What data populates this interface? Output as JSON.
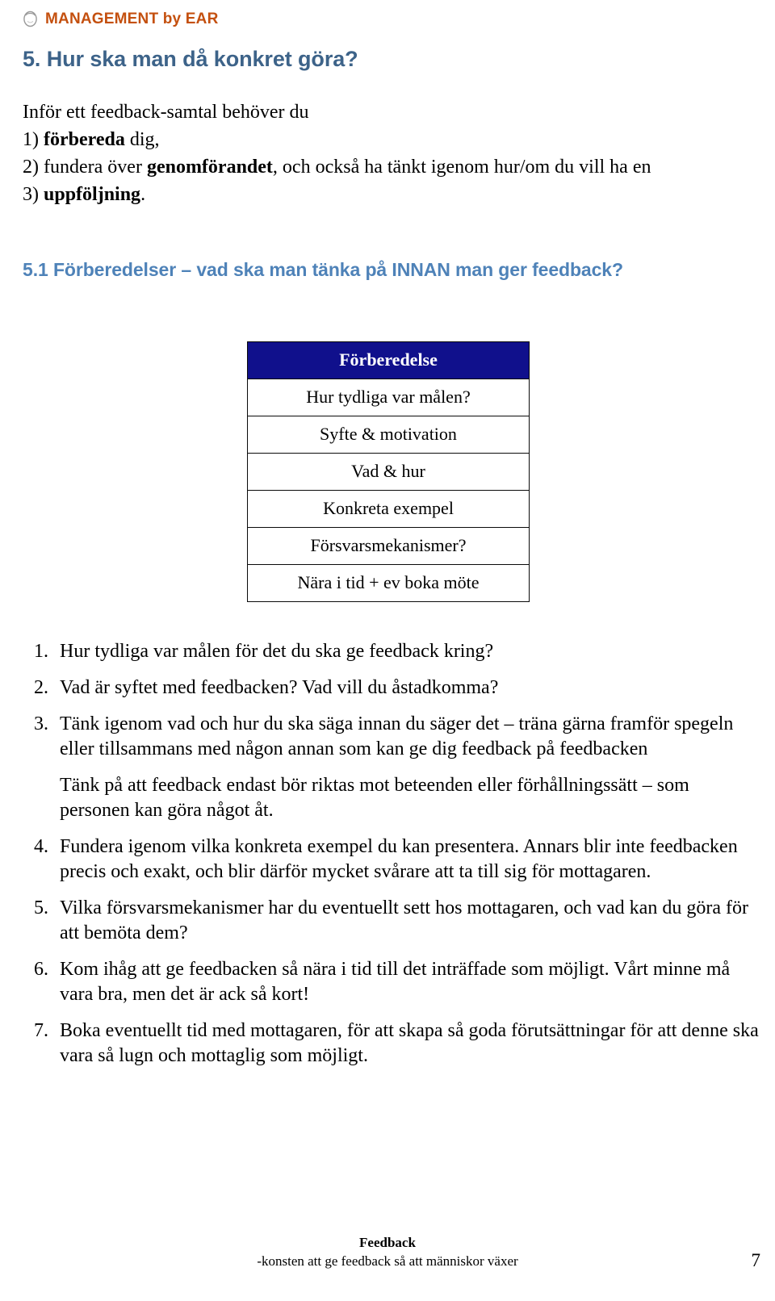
{
  "brand": {
    "logo_icon": "head-outline-icon",
    "text": "MANAGEMENT by EAR",
    "color": "#c4500f"
  },
  "headings": {
    "section": "5. Hur ska man då konkret göra?",
    "section_color": "#3d6389",
    "subsection": "5.1 Förberedelser – vad ska man tänka på INNAN man ger feedback?",
    "subsection_color": "#4e82b8"
  },
  "intro": {
    "line1": "Inför ett feedback-samtal behöver du",
    "line2_num": "1)",
    "line2_bold": "förbereda",
    "line2_rest": " dig,",
    "line3_num": "2)",
    "line3_pre": " fundera över ",
    "line3_bold": "genomförandet",
    "line3_rest": ", och också ha tänkt igenom hur/om du vill ha en",
    "line4_num": "3)",
    "line4_bold": "uppföljning",
    "line4_rest": "."
  },
  "prep_table": {
    "header": "Förberedelse",
    "header_bg": "#10108c",
    "rows": [
      "Hur tydliga var målen?",
      "Syfte & motivation",
      "Vad & hur",
      "Konkreta exempel",
      "Försvarsmekanismer?",
      "Nära i tid + ev boka möte"
    ]
  },
  "list": {
    "items": [
      {
        "num": "1.",
        "text": "Hur tydliga var målen för det du ska ge feedback kring?",
        "extra": null
      },
      {
        "num": "2.",
        "text": "Vad är syftet med feedbacken? Vad vill du åstadkomma?",
        "extra": null
      },
      {
        "num": "3.",
        "text": "Tänk igenom vad och hur du ska säga innan du säger det – träna gärna framför spegeln eller tillsammans med någon annan som kan ge dig feedback på feedbacken",
        "extra": "Tänk på att feedback endast bör riktas mot beteenden eller förhållningssätt – som personen kan göra något åt."
      },
      {
        "num": "4.",
        "text": "Fundera igenom vilka konkreta exempel du kan presentera. Annars blir inte feedbacken precis och exakt, och blir därför mycket svårare att ta till sig för mottagaren.",
        "extra": null
      },
      {
        "num": "5.",
        "text": "Vilka försvarsmekanismer har du eventuellt sett hos mottagaren, och vad kan du göra för att bemöta dem?",
        "extra": null
      },
      {
        "num": "6.",
        "text": "Kom ihåg att ge feedbacken så nära i tid till det inträffade som möjligt. Vårt minne må vara bra, men det är ack så kort!",
        "extra": null
      },
      {
        "num": "7.",
        "text": "Boka eventuellt tid med mottagaren, för att skapa så goda förutsättningar för att denne ska vara så lugn och mottaglig som möjligt.",
        "extra": null
      }
    ]
  },
  "footer": {
    "title": "Feedback",
    "subtitle": "-konsten att ge feedback så att människor växer",
    "page_number": "7"
  }
}
